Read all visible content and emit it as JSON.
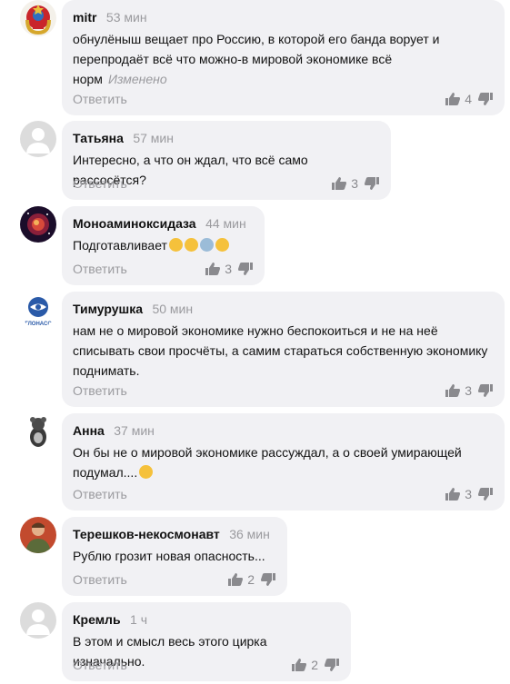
{
  "reply_label": "Ответить",
  "comments": [
    {
      "author": "mitr",
      "time": "53 мин",
      "text": "обнулёныш вещает про Россию, в которой его банда ворует и\nперепродаёт всё что можно-в мировой экономике всё\nнорм",
      "edited": "Изменено",
      "likes": "4",
      "avatar_icon": "soviet-emblem-avatar"
    },
    {
      "author": "Татьяна",
      "time": "57 мин",
      "text": "Интересно, а что он ждал, что всё само рассосётся?",
      "likes": "3",
      "avatar_icon": "default-user-avatar"
    },
    {
      "author": "Моноаминоксидаза",
      "time": "44 мин",
      "text": "Подготавливает",
      "emojis": [
        "laughing-face-emoji",
        "astonished-face-emoji",
        "person-emoji",
        "crying-face-emoji"
      ],
      "likes": "3",
      "avatar_icon": "galaxy-avatar"
    },
    {
      "author": "Тимурушка",
      "time": "50 мин",
      "text": "нам не о мировой экономике нужно беспокоиться и не на неё\nсписывать свои просчёты, а самим стараться собственную экономику\nподнимать.",
      "likes": "3",
      "avatar_icon": "glonass-logo-avatar",
      "avatar_text": "ГЛОНАСС"
    },
    {
      "author": "Анна",
      "time": "37 мин",
      "text": "Он бы не о мировой экономике рассуждал, а о своей умирающей\nподумал....",
      "emojis": [
        "frowning-face-emoji"
      ],
      "likes": "3",
      "avatar_icon": "rat-avatar"
    },
    {
      "author": "Терешков-некосмонавт",
      "time": "36 мин",
      "text": "Рублю грозит новая опасность...",
      "likes": "2",
      "avatar_icon": "portrait-avatar"
    },
    {
      "author": "Кремль",
      "time": "1 ч",
      "text": "В этом и смысл весь этого цирка изначально.",
      "likes": "2",
      "avatar_icon": "default-user-avatar"
    }
  ],
  "colors": {
    "bubble": "#f1f1f4",
    "muted": "#9a9a9e",
    "text": "#111111"
  }
}
